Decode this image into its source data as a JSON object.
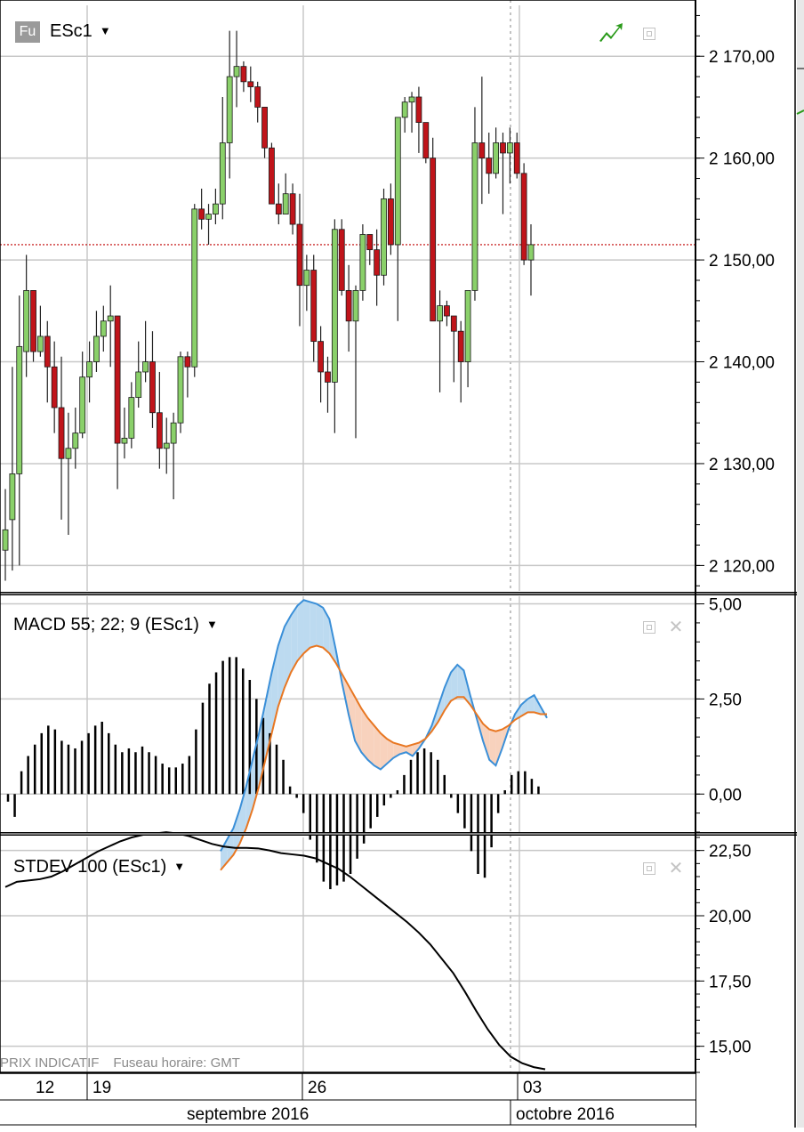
{
  "header": {
    "symbol_badge": "Fu",
    "symbol": "ESc1",
    "macd_title": "MACD 55; 22; 9 (ESc1)",
    "stdev_title": "STDEV 100 (ESc1)",
    "footnote_left": "PRIX INDICATIF",
    "footnote_right": "Fuseau horaire: GMT"
  },
  "colors": {
    "up": "#8ad06a",
    "down": "#c0141a",
    "wick": "#222222",
    "macd_line": "#3a8fd8",
    "signal_line": "#e87722",
    "fill_above": "#bcdaf0",
    "fill_below": "#f8d2bd",
    "reference_line": "#c00000",
    "grid": "#c8c8c8",
    "stdev_line": "#000000"
  },
  "chart_data": [
    {
      "type": "candlestick",
      "title": "ESc1",
      "ylim": [
        2117.5,
        2175
      ],
      "yticks": [
        2120,
        2130,
        2140,
        2150,
        2160,
        2170
      ],
      "ytick_labels": [
        "2 120,00",
        "2 130,00",
        "2 140,00",
        "2 150,00",
        "2 160,00",
        "2 170,00"
      ],
      "reference_price": 2151.5,
      "candles": [
        [
          2121.5,
          2127.5,
          2118.5,
          2123.5
        ],
        [
          2124.5,
          2139.5,
          2119.5,
          2129
        ],
        [
          2129,
          2146.5,
          2120,
          2141.5
        ],
        [
          2141,
          2150.5,
          2138.5,
          2147
        ],
        [
          2147,
          2147,
          2140,
          2141
        ],
        [
          2141,
          2145.5,
          2140.5,
          2142.5
        ],
        [
          2142.5,
          2144,
          2136,
          2139.5
        ],
        [
          2139.5,
          2142,
          2133,
          2135.5
        ],
        [
          2135.5,
          2140.5,
          2124.5,
          2130.5
        ],
        [
          2130.5,
          2135,
          2123,
          2131.5
        ],
        [
          2131.5,
          2135.5,
          2129.5,
          2133
        ],
        [
          2133,
          2141,
          2132.5,
          2138.5
        ],
        [
          2138.5,
          2142,
          2136,
          2140
        ],
        [
          2140,
          2145,
          2139,
          2142.5
        ],
        [
          2142.5,
          2145.5,
          2141,
          2144
        ],
        [
          2144,
          2147.5,
          2139.5,
          2144.5
        ],
        [
          2144.5,
          2143.5,
          2127.5,
          2132
        ],
        [
          2132,
          2135.5,
          2130.5,
          2132.5
        ],
        [
          2132.5,
          2138,
          2131.5,
          2136.5
        ],
        [
          2136.5,
          2142,
          2135.5,
          2139
        ],
        [
          2139,
          2144,
          2138,
          2140
        ],
        [
          2140,
          2143,
          2133.5,
          2135
        ],
        [
          2135,
          2139,
          2129.5,
          2131.5
        ],
        [
          2131.5,
          2134.5,
          2129,
          2132
        ],
        [
          2132,
          2135,
          2126.5,
          2134
        ],
        [
          2134,
          2141,
          2133,
          2140.5
        ],
        [
          2140.5,
          2141,
          2136.5,
          2139.5
        ],
        [
          2139.5,
          2155.5,
          2138.5,
          2155
        ],
        [
          2155,
          2157,
          2153,
          2154
        ],
        [
          2154,
          2155.5,
          2151.5,
          2154.5
        ],
        [
          2154.5,
          2157,
          2153.5,
          2155.5
        ],
        [
          2155.5,
          2166,
          2154,
          2161.5
        ],
        [
          2161.5,
          2172.5,
          2158,
          2168
        ],
        [
          2168,
          2172.5,
          2165,
          2169
        ],
        [
          2169,
          2169.5,
          2166.5,
          2167.5
        ],
        [
          2167.5,
          2169,
          2165.5,
          2167
        ],
        [
          2167,
          2167.5,
          2163.5,
          2165
        ],
        [
          2165,
          2164.5,
          2160,
          2161
        ],
        [
          2161,
          2161.5,
          2158,
          2155.5
        ],
        [
          2155.5,
          2157.5,
          2153.5,
          2154.5
        ],
        [
          2154.5,
          2158.5,
          2155,
          2156.5
        ],
        [
          2156.5,
          2157.5,
          2152.5,
          2153.5
        ],
        [
          2153.5,
          2156.5,
          2143.5,
          2147.5
        ],
        [
          2147.5,
          2150.5,
          2145,
          2149
        ],
        [
          2149,
          2150.5,
          2140,
          2142
        ],
        [
          2142,
          2143.5,
          2136,
          2139
        ],
        [
          2139,
          2140.5,
          2135,
          2138
        ],
        [
          2138,
          2154,
          2133,
          2153
        ],
        [
          2153,
          2154,
          2146.5,
          2147
        ],
        [
          2147,
          2149.5,
          2141,
          2144
        ],
        [
          2144,
          2147.5,
          2132.5,
          2147
        ],
        [
          2147,
          2153.5,
          2146,
          2152.5
        ],
        [
          2152.5,
          2152.5,
          2149.5,
          2151
        ],
        [
          2151,
          2153,
          2145.5,
          2148.5
        ],
        [
          2148.5,
          2157,
          2147.5,
          2156
        ],
        [
          2156,
          2157.5,
          2150.5,
          2151.5
        ],
        [
          2151.5,
          2158.5,
          2144,
          2164
        ],
        [
          2164,
          2166,
          2162.5,
          2165.5
        ],
        [
          2165.5,
          2166.5,
          2162.5,
          2166
        ],
        [
          2166,
          2167,
          2160.5,
          2163.5
        ],
        [
          2163.5,
          2162.5,
          2159.5,
          2160
        ],
        [
          2160,
          2162,
          2145.5,
          2144
        ],
        [
          2144,
          2147,
          2137,
          2145.5
        ],
        [
          2145.5,
          2146,
          2143.5,
          2144.5
        ],
        [
          2144.5,
          2143,
          2138,
          2143
        ],
        [
          2143,
          2144,
          2136,
          2140
        ],
        [
          2140,
          2142,
          2137.5,
          2147
        ],
        [
          2147,
          2165,
          2146,
          2161.5
        ],
        [
          2161.5,
          2168,
          2155.5,
          2160
        ],
        [
          2160,
          2162.5,
          2156.5,
          2158.5
        ],
        [
          2158.5,
          2163,
          2158,
          2161.5
        ],
        [
          2161.5,
          2162.5,
          2154.5,
          2160.5
        ],
        [
          2160.5,
          2163,
          2157.5,
          2161.5
        ],
        [
          2161.5,
          2162.5,
          2158,
          2158.5
        ],
        [
          2158.5,
          2159.5,
          2149.5,
          2150
        ],
        [
          2150,
          2153.5,
          2146.5,
          2151.5
        ]
      ]
    },
    {
      "type": "line",
      "title": "MACD 55; 22; 9 (ESc1)",
      "ylim": [
        -1,
        5.2
      ],
      "yticks": [
        0,
        2.5,
        5
      ],
      "ytick_labels": [
        "0,00",
        "2,50",
        "5,00"
      ],
      "macd": [
        -1.5,
        -1.2,
        -0.9,
        -0.4,
        0.2,
        0.9,
        1.6,
        2.4,
        3.2,
        3.9,
        4.4,
        4.7,
        4.95,
        5.1,
        5.05,
        5.0,
        4.9,
        4.6,
        3.8,
        2.9,
        2.1,
        1.4,
        1.1,
        0.9,
        0.75,
        0.65,
        0.8,
        0.95,
        1.05,
        1.1,
        1.0,
        1.2,
        1.45,
        1.8,
        2.3,
        2.8,
        3.2,
        3.4,
        3.25,
        2.6,
        2.0,
        1.4,
        0.9,
        0.75,
        1.2,
        1.7,
        2.1,
        2.35,
        2.5,
        2.6,
        2.3,
        2.0
      ],
      "signal": [
        -2.0,
        -1.8,
        -1.6,
        -1.3,
        -0.9,
        -0.4,
        0.2,
        0.9,
        1.6,
        2.3,
        2.8,
        3.2,
        3.5,
        3.7,
        3.85,
        3.9,
        3.85,
        3.7,
        3.45,
        3.15,
        2.85,
        2.55,
        2.25,
        2.0,
        1.8,
        1.6,
        1.45,
        1.35,
        1.3,
        1.25,
        1.3,
        1.35,
        1.45,
        1.65,
        1.9,
        2.2,
        2.45,
        2.55,
        2.55,
        2.35,
        2.1,
        1.85,
        1.7,
        1.65,
        1.7,
        1.8,
        1.95,
        2.05,
        2.15,
        2.15,
        2.1,
        2.1
      ],
      "histogram": [
        -0.2,
        -0.6,
        0.6,
        1.0,
        1.3,
        1.6,
        1.8,
        1.7,
        1.4,
        1.3,
        1.2,
        1.4,
        1.6,
        1.8,
        1.9,
        1.6,
        1.3,
        1.1,
        1.2,
        1.1,
        1.25,
        1.1,
        1.0,
        0.8,
        0.7,
        0.7,
        0.8,
        1.0,
        1.7,
        2.4,
        2.9,
        3.2,
        3.5,
        3.6,
        3.6,
        3.3,
        3.0,
        2.5,
        2.0,
        1.6,
        1.3,
        0.9,
        0.2,
        -0.1,
        -0.5,
        -1.2,
        -1.8,
        -2.3,
        -2.5,
        -2.4,
        -2.3,
        -2.1,
        -1.7,
        -1.3,
        -0.9,
        -0.6,
        -0.3,
        -0.1,
        0.1,
        0.5,
        0.9,
        1.1,
        1.2,
        1.1,
        0.9,
        0.5,
        -0.1,
        -0.5,
        -0.9,
        -1.5,
        -2.1,
        -2.2,
        -1.4,
        -0.5,
        0.1,
        0.5,
        0.6,
        0.6,
        0.4,
        0.2,
        0.0
      ]
    },
    {
      "type": "line",
      "title": "STDEV 100 (ESc1)",
      "ylim": [
        14,
        23
      ],
      "yticks": [
        15,
        17.5,
        20,
        22.5
      ],
      "ytick_labels": [
        "15,00",
        "17,50",
        "20,00",
        "22,50"
      ],
      "values": [
        21.1,
        21.3,
        21.35,
        21.4,
        21.5,
        21.7,
        21.95,
        22.2,
        22.45,
        22.65,
        22.85,
        23.0,
        23.1,
        23.15,
        23.2,
        23.15,
        23.05,
        22.9,
        22.75,
        22.65,
        22.6,
        22.6,
        22.58,
        22.5,
        22.4,
        22.35,
        22.3,
        22.2,
        22.0,
        21.8,
        21.5,
        21.15,
        20.8,
        20.45,
        20.1,
        19.75,
        19.35,
        18.9,
        18.35,
        17.8,
        17.1,
        16.35,
        15.65,
        15.05,
        14.6,
        14.35,
        14.2,
        14.12
      ]
    }
  ],
  "x_axis": {
    "day_labels": [
      "12",
      "19",
      "26",
      "03"
    ],
    "month_labels": [
      "septembre 2016",
      "octobre 2016"
    ]
  }
}
